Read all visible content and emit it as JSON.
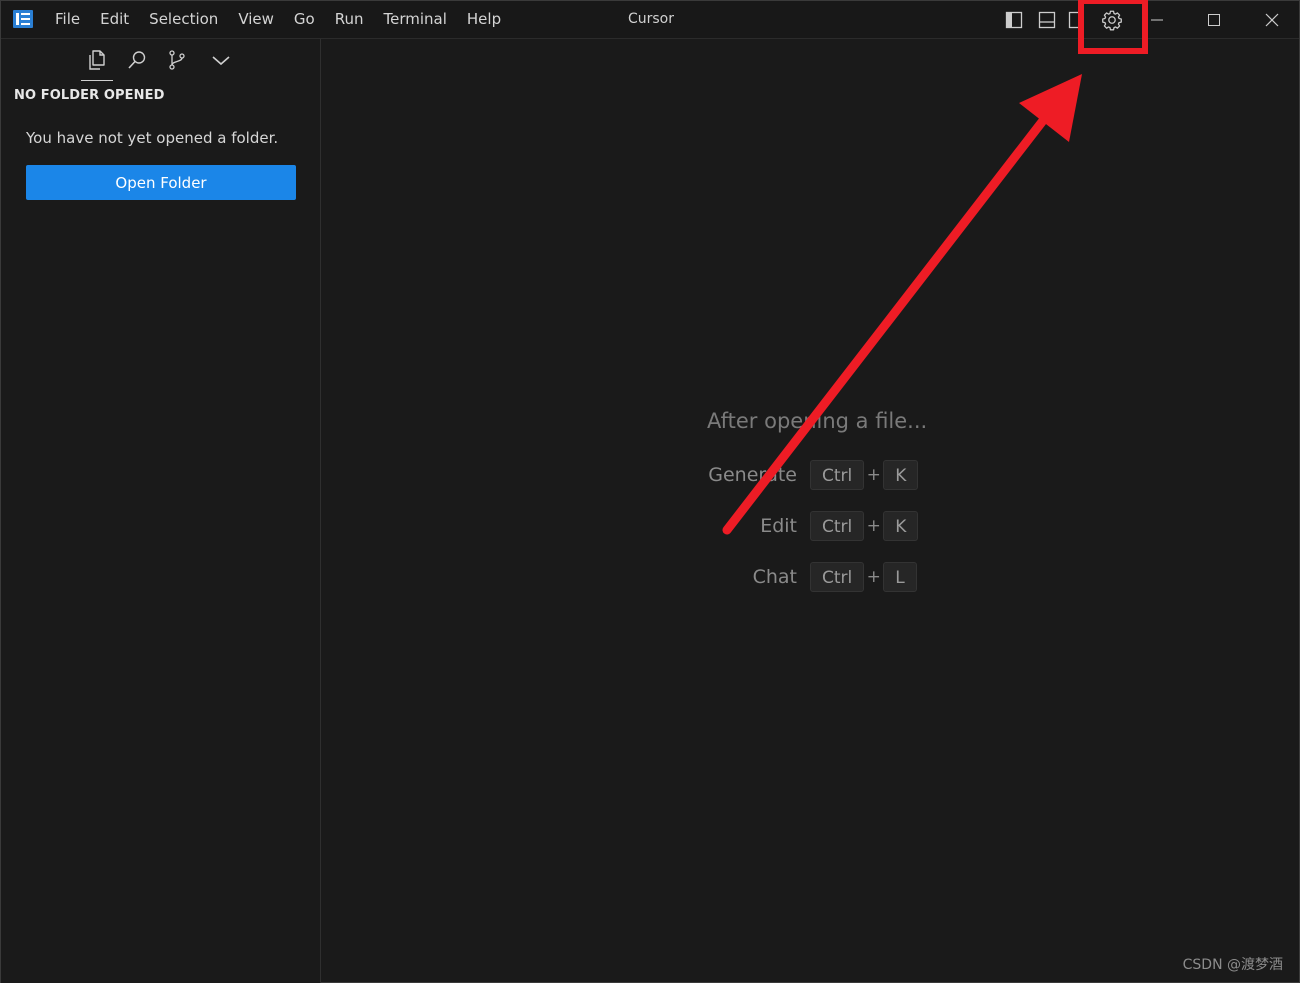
{
  "menu": [
    "File",
    "Edit",
    "Selection",
    "View",
    "Go",
    "Run",
    "Terminal",
    "Help"
  ],
  "window_title": "Cursor",
  "sidebar": {
    "header": "NO FOLDER OPENED",
    "message": "You have not yet opened a folder.",
    "open_folder_label": "Open Folder"
  },
  "editor_hints": {
    "title": "After opening a file...",
    "rows": [
      {
        "label": "Generate",
        "mod": "Ctrl",
        "key": "K"
      },
      {
        "label": "Edit",
        "mod": "Ctrl",
        "key": "K"
      },
      {
        "label": "Chat",
        "mod": "Ctrl",
        "key": "L"
      }
    ],
    "plus": "+"
  },
  "watermark": "CSDN @渡梦酒",
  "colors": {
    "accent_button": "#1b86e8",
    "annotation_red": "#ee1c25"
  }
}
